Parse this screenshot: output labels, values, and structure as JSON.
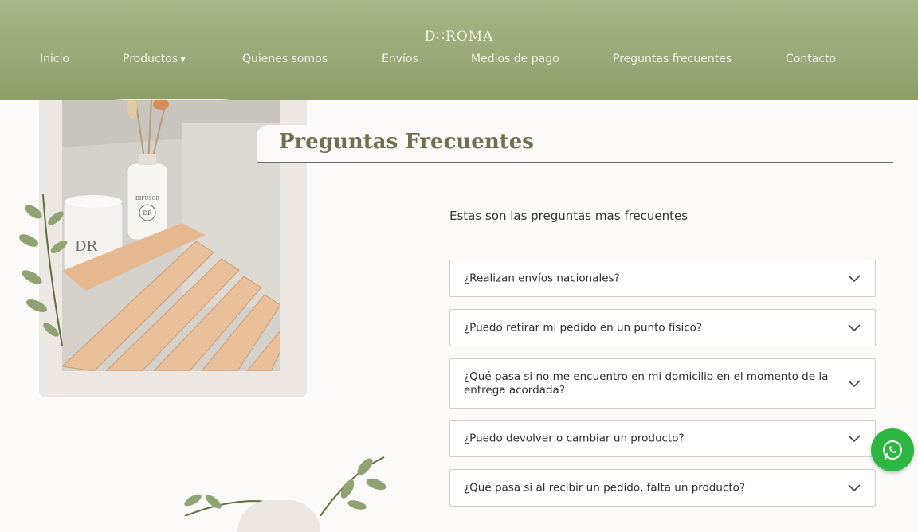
{
  "header": {
    "logo": "D∷ROMA",
    "nav": [
      {
        "label": "Inicio"
      },
      {
        "label": "Productos"
      },
      {
        "label": "Quienes somos"
      },
      {
        "label": "Envíos"
      },
      {
        "label": "Medios de pago"
      },
      {
        "label": "Preguntas frecuentes"
      },
      {
        "label": "Contacto"
      }
    ]
  },
  "main": {
    "title": "Preguntas Frecuentes",
    "intro": "Estas son las preguntas mas frecuentes",
    "faq": [
      {
        "question": "¿Realizan envíos nacionales?"
      },
      {
        "question": "¿Puedo retirar mi pedido en un punto físico?"
      },
      {
        "question": "¿Qué pasa si no me encuentro en mi domicilio en el momento de la entrega acordada?"
      },
      {
        "question": "¿Puedo devolver o cambiar un producto?"
      },
      {
        "question": "¿Qué pasa si al recibir un pedido, falta un producto?"
      }
    ]
  },
  "photo": {
    "candle_label": "DR",
    "diffuser_label": "DIFUSOR",
    "diffuser_logo": "DR"
  },
  "icons": {
    "dropdown": "caret-down-icon",
    "faq_toggle": "chevron-down-icon",
    "chat": "whatsapp-icon"
  },
  "colors": {
    "header_bg": "#9aa978",
    "title": "#6e7051",
    "whatsapp": "#2db742"
  }
}
